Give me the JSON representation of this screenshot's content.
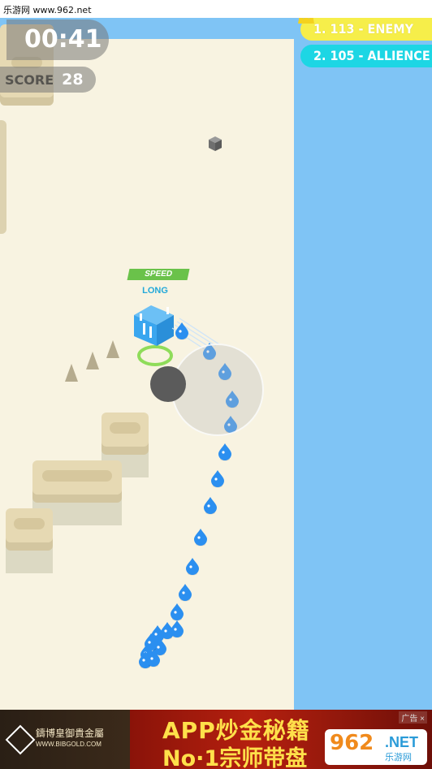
{
  "watermark": "乐游网 www.962.net",
  "hud": {
    "timer": "00:41",
    "score_label": "SCORE",
    "score_value": "28"
  },
  "leaderboard": [
    {
      "text": "1. 113 - ENEMY",
      "color": "#f6ee4a"
    },
    {
      "text": "2. 105 - ALLIENCE",
      "color": "#1dd6e4"
    }
  ],
  "player": {
    "badge": "SPEED",
    "name": "LONG",
    "color": "#3aa6ef"
  },
  "colors": {
    "arena": "#f8f3e1",
    "water": "#7fc4f5",
    "follower": "#2b8ff0"
  },
  "ad": {
    "brand": "鑄博皇御貴金屬",
    "url": "WWW.BIBGOLD.COM",
    "line1": "APP炒金秘籍",
    "line2": "No·1宗师带盘",
    "tag": "广告 ×"
  },
  "site_logo": {
    "number": "962",
    "suffix": ".NET",
    "cn": "乐游网"
  }
}
